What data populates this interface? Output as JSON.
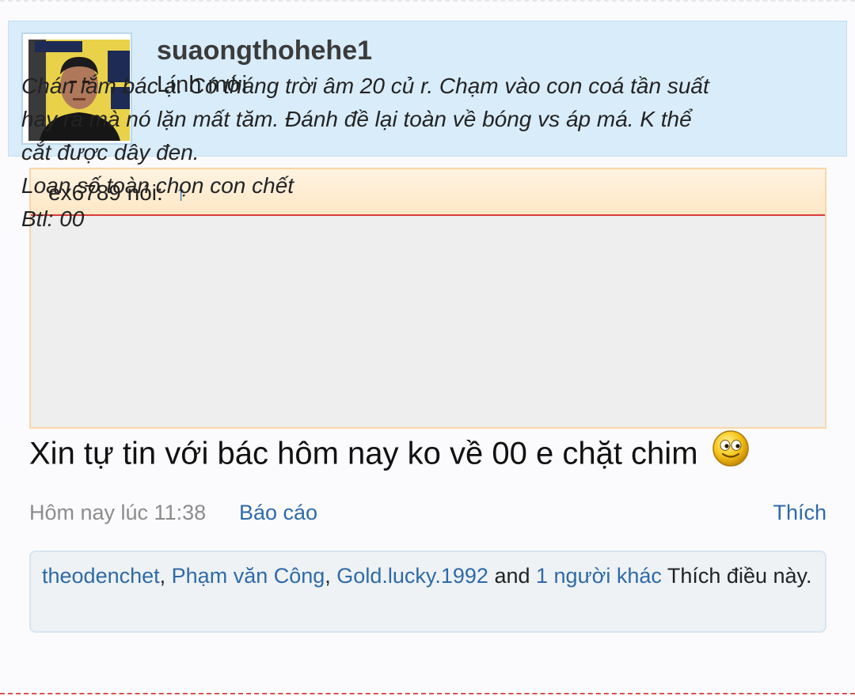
{
  "post": {
    "author": {
      "username": "suaongthohehe1",
      "title": "Lính mới"
    },
    "quote": {
      "author_label": "ex6789 nói:",
      "jump_icon": "↑",
      "lines": [
        "Chán lắm bác ạ. Có tháng trời âm 20 củ r. Chạm vào con coá tần suất",
        "hay ra mà nó lặn mất tăm. Đánh đề lại toàn về bóng vs áp má. K thể",
        "cắt được dây đen.",
        "Loạn số toàn chọn con chết",
        "Btl: 00"
      ]
    },
    "message": "Xin tự tin với bác hôm nay ko về 00 e chặt chim",
    "message_icon": "smiley-icon",
    "meta": {
      "time": "Hôm nay lúc 11:38",
      "report": "Báo cáo",
      "like": "Thích"
    },
    "likes": {
      "users": [
        "theodenchet",
        "Phạm văn Công",
        "Gold.lucky.1992"
      ],
      "and_text": "and",
      "others": "1 người khác",
      "suffix": "Thích điều này."
    }
  },
  "colors": {
    "link": "#2e6aa8",
    "header_bg": "#d8ecfa",
    "quote_border": "#d93b3b",
    "quote_head_bg": "#fde7c6"
  }
}
